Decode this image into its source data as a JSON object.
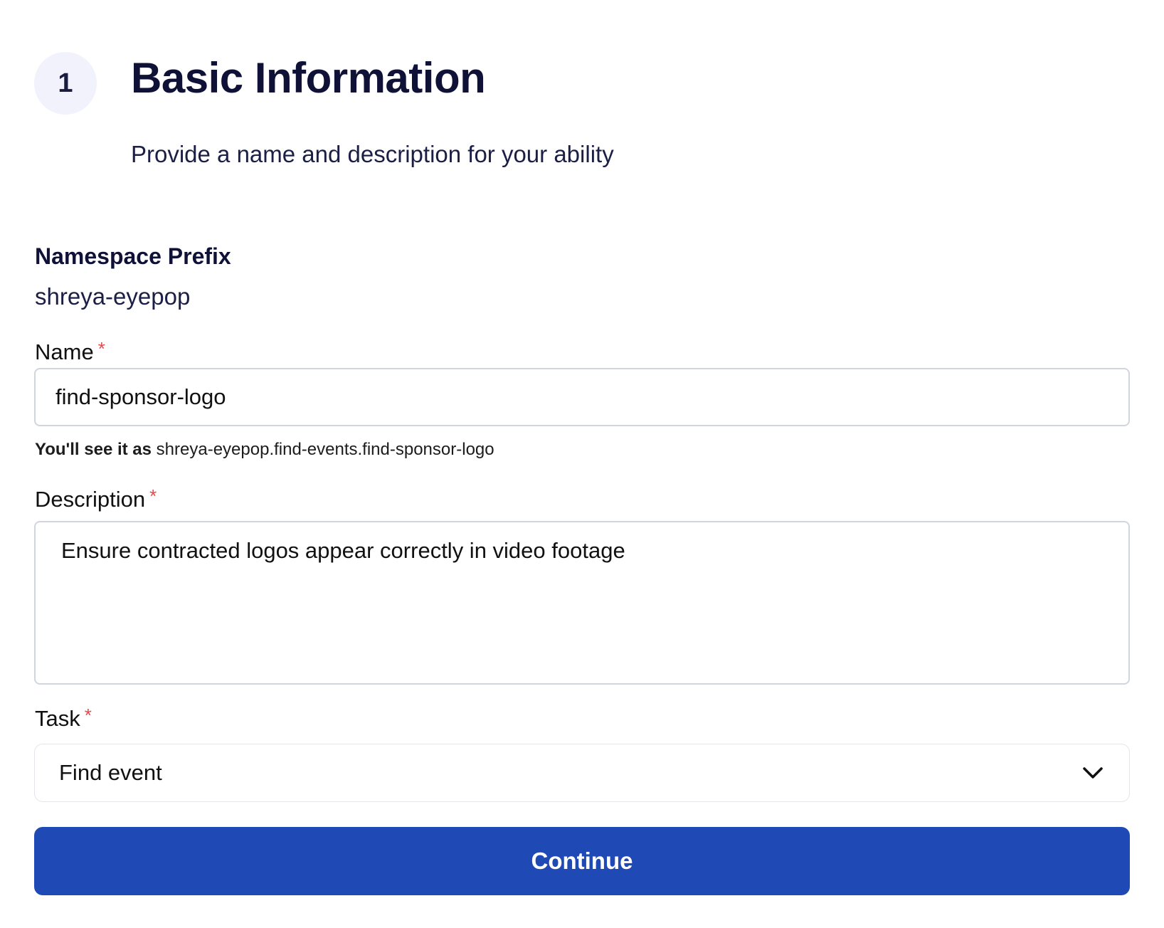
{
  "step": {
    "number": "1",
    "title": "Basic Information",
    "subtitle": "Provide a name and description for your ability"
  },
  "namespace": {
    "label": "Namespace Prefix",
    "value": "shreya-eyepop"
  },
  "name_field": {
    "label": "Name",
    "required_marker": "*",
    "value": "find-sponsor-logo",
    "helper_prefix": "You'll see it as",
    "helper_value": "shreya-eyepop.find-events.find-sponsor-logo"
  },
  "description_field": {
    "label": "Description",
    "required_marker": "*",
    "value": "Ensure contracted logos appear correctly in video footage"
  },
  "task_field": {
    "label": "Task",
    "required_marker": "*",
    "selected": "Find event",
    "icon": "chevron-down-icon"
  },
  "actions": {
    "continue_label": "Continue"
  },
  "colors": {
    "primary_button": "#1f4ab5",
    "required_asterisk": "#e5484d",
    "heading_text": "#0f1136",
    "step_circle_bg": "#f1f2fb"
  }
}
